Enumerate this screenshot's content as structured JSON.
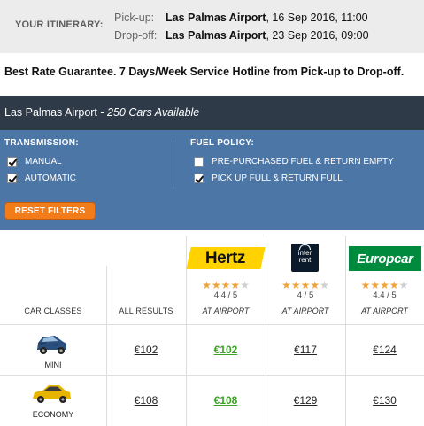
{
  "itinerary": {
    "label": "YOUR ITINERARY:",
    "pickup_key": "Pick-up:",
    "pickup_location": "Las Palmas Airport",
    "pickup_datetime": ", 16 Sep 2016, 11:00",
    "dropoff_key": "Drop-off:",
    "dropoff_location": "Las Palmas Airport",
    "dropoff_datetime": ", 23 Sep 2016, 09:00"
  },
  "guarantee": "Best Rate Guarantee. 7 Days/Week Service Hotline from Pick-up to Drop-off.",
  "location_bar": {
    "location": "Las Palmas Airport",
    "separator": " - ",
    "available": "250 Cars Available"
  },
  "filters": {
    "transmission_title": "TRANSMISSION:",
    "transmission": [
      {
        "label": "MANUAL",
        "checked": true
      },
      {
        "label": "AUTOMATIC",
        "checked": true
      }
    ],
    "fuel_title": "FUEL POLICY:",
    "fuel": [
      {
        "label": "PRE-PURCHASED FUEL & RETURN EMPTY",
        "checked": false
      },
      {
        "label": "PICK UP FULL & RETURN FULL",
        "checked": true
      }
    ],
    "reset_label": "RESET FILTERS"
  },
  "colors": {
    "location_bar": "#2f3a48",
    "filter_panel": "#4c76a6",
    "reset_button": "#f27b1a",
    "best_price": "#3aa323",
    "star": "#f0a33a"
  },
  "table": {
    "col_car_classes": "CAR CLASSES",
    "col_all_results": "ALL RESULTS",
    "suppliers": [
      {
        "name": "Hertz",
        "logo": "Hertz",
        "stars": 4,
        "rating": "4.4 / 5",
        "location": "AT AIRPORT"
      },
      {
        "name": "InterRent",
        "logo_line1": "inter",
        "logo_line2": "rent",
        "stars": 4,
        "rating": "4 / 5",
        "location": "AT AIRPORT"
      },
      {
        "name": "Europcar",
        "logo": "Europcar",
        "stars": 4,
        "rating": "4.4 / 5",
        "location": "AT AIRPORT"
      }
    ],
    "rows": [
      {
        "class": "MINI",
        "car_icon": "mini-car-icon",
        "all": "€102",
        "prices": [
          "€102",
          "€117",
          "€124"
        ],
        "best_index": 0
      },
      {
        "class": "ECONOMY",
        "car_icon": "economy-car-icon",
        "all": "€108",
        "prices": [
          "€108",
          "€129",
          "€130"
        ],
        "best_index": 0
      }
    ]
  }
}
